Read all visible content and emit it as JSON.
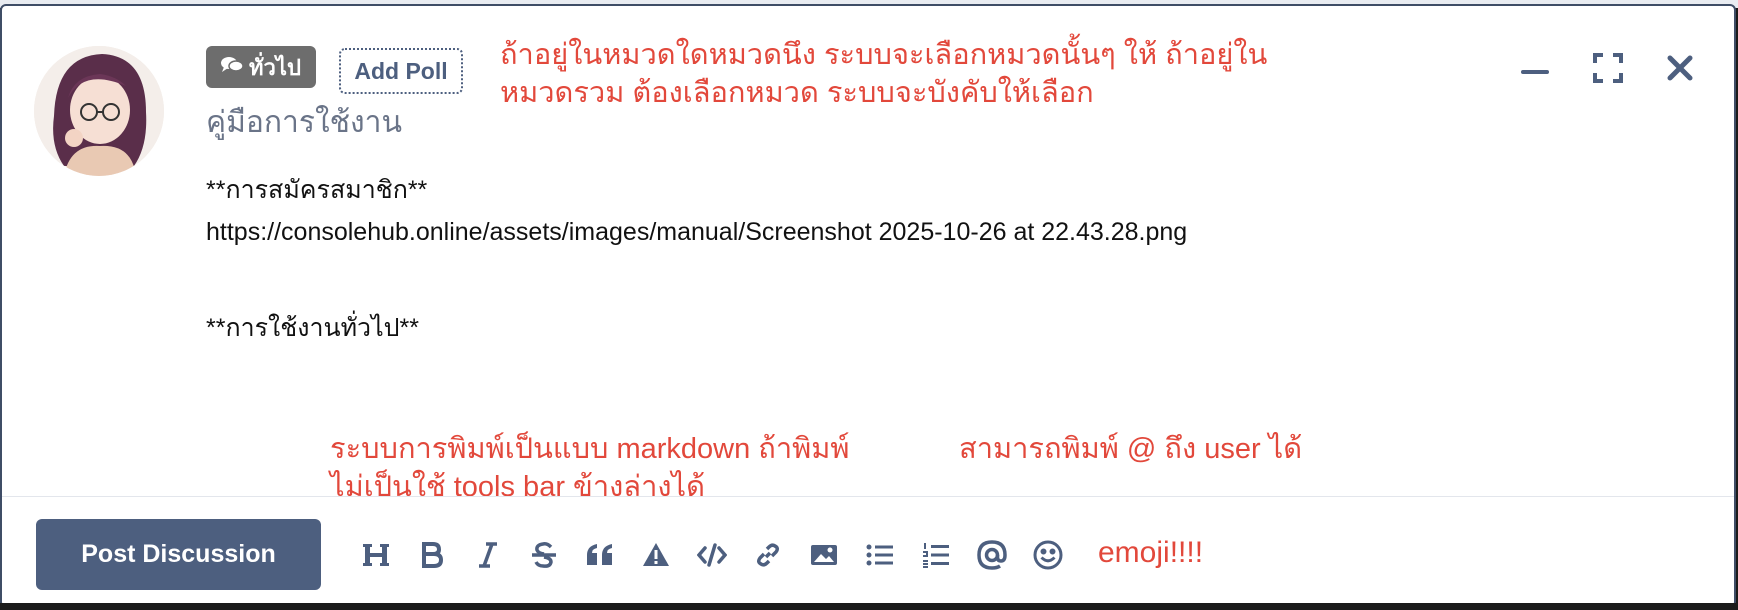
{
  "composer": {
    "tag_label": "ทั่วไป",
    "add_poll_label": "Add Poll",
    "title": "คู่มือการใช้งาน",
    "body_lines": [
      "**การสมัครสมาชิก**",
      "https://consolehub.online/assets/images/manual/Screenshot 2025-10-26 at 22.43.28.png",
      "**การใช้งานทั่วไป**"
    ],
    "post_button_label": "Post Discussion"
  },
  "annotations": {
    "category_note_line1": "ถ้าอยู่ในหมวดใดหมวดนึง ระบบจะเลือกหมวดนั้นๆ ให้ ถ้าอยู่ใน",
    "category_note_line2": "หมวดรวม ต้องเลือกหมวด ระบบจะบังคับให้เลือก",
    "markdown_note_line1": "ระบบการพิมพ์เป็นแบบ markdown ถ้าพิมพ์",
    "markdown_note_line2": "ไม่เป็นใช้ tools bar ข้างล่างได้",
    "mention_note": "สามารถพิมพ์ @ ถึง user ได้",
    "emoji_note": "emoji!!!!"
  },
  "window_controls": [
    "minimize-icon",
    "fullscreen-icon",
    "close-icon"
  ],
  "toolbar_icons": [
    "heading-icon",
    "bold-icon",
    "italic-icon",
    "strikethrough-icon",
    "quote-icon",
    "spoiler-icon",
    "code-icon",
    "link-icon",
    "image-icon",
    "bullet-list-icon",
    "ordered-list-icon",
    "mention-icon",
    "emoji-icon"
  ],
  "colors": {
    "accent": "#4d5f7f",
    "annotation_red": "#e2483b",
    "tag_gray": "#6d6d6d"
  }
}
